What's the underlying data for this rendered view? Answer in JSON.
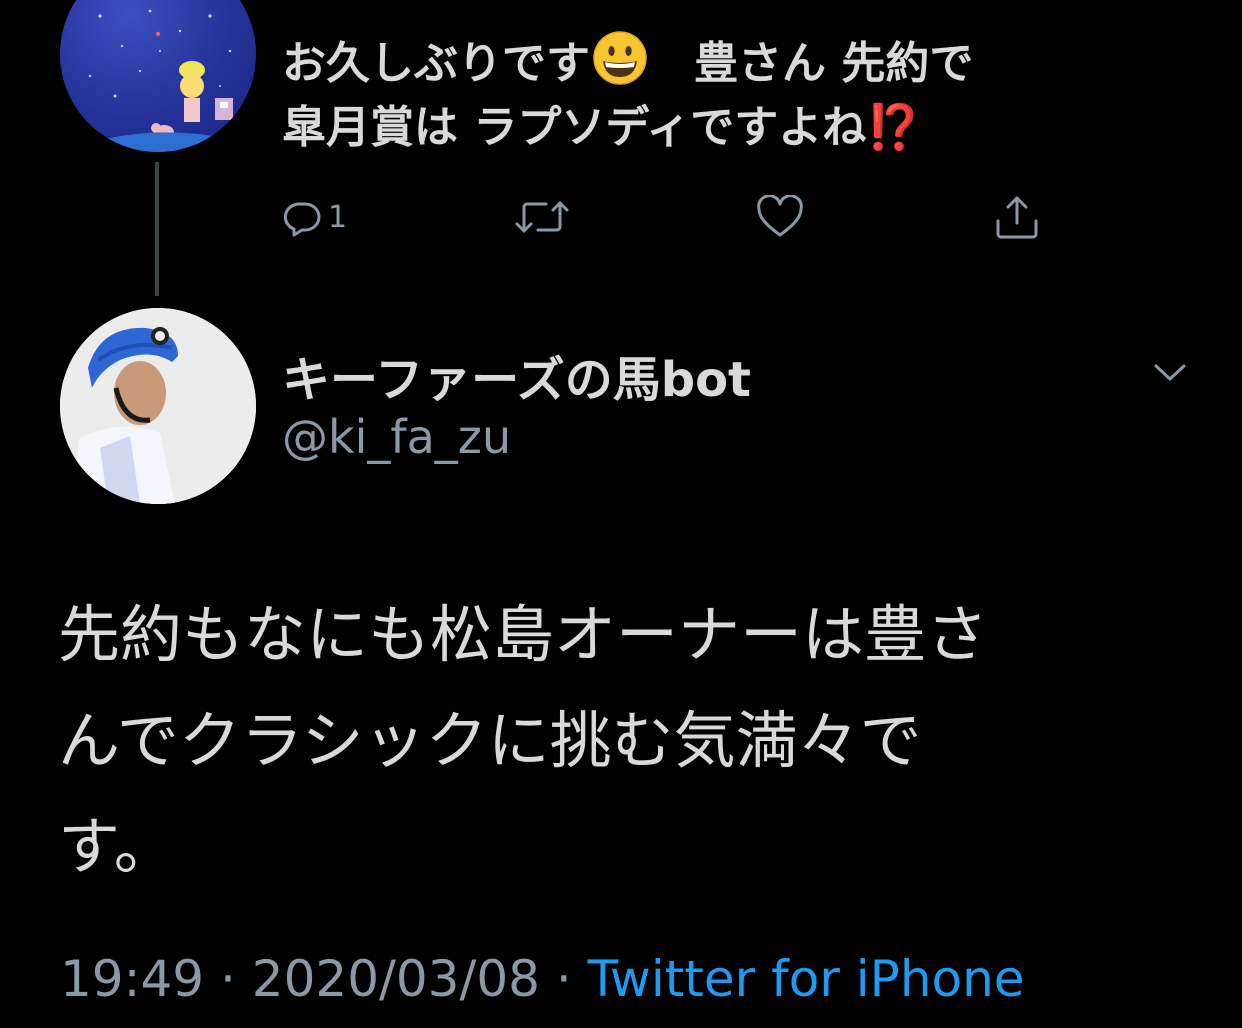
{
  "parent_tweet": {
    "name_cut": "",
    "text_lines": [
      [
        "お久しぶりです",
        "grin-emoji",
        "　豊さん 先約で"
      ],
      [
        "皐月賞は ラプソディですよね",
        "interrobang-emoji"
      ]
    ],
    "line1_part1": "お久しぶりです",
    "line1_part2": "　豊さん  先約で",
    "line2_part1": "皐月賞は  ラプソディですよね",
    "interrobang": "⁉️",
    "reply_count": "1",
    "icons": [
      "reply-icon",
      "retweet-icon",
      "like-icon",
      "share-icon"
    ]
  },
  "main_tweet": {
    "display_name": "キーファーズの馬bot",
    "handle": "@ki_fa_zu",
    "body_line1": "先約もなにも松島オーナーは豊さ",
    "body_line2": "んでクラシックに挑む気満々で",
    "body_line3": "す。",
    "time": "19:49",
    "date": "2020/03/08",
    "separator": " · ",
    "source": "Twitter for iPhone"
  },
  "colors": {
    "background": "#000000",
    "text": "#d9d9d9",
    "muted": "#8b98a5",
    "link": "#1d9bf0",
    "interrobang": "#e0322d",
    "thread_line": "#3d4247"
  }
}
